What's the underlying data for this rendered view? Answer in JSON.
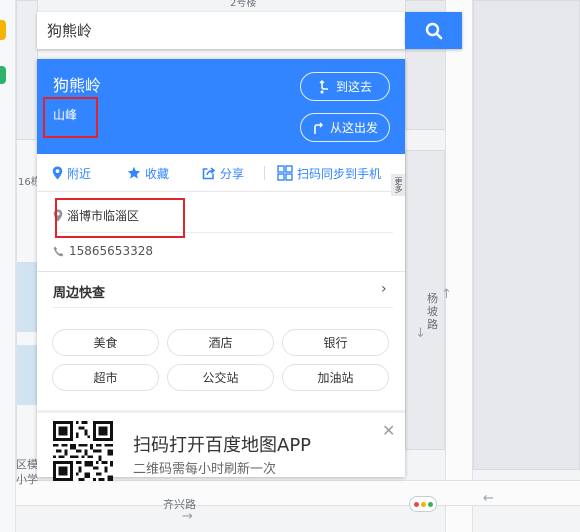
{
  "search": {
    "value": "狗熊岭",
    "clear_icon": "close-icon",
    "search_icon": "search-icon",
    "accent_color": "#3385ff"
  },
  "place": {
    "name": "狗熊岭",
    "category": "山峰",
    "go_here_label": "到这去",
    "depart_from_label": "从这出发",
    "header_color": "#3385ff"
  },
  "actions": [
    {
      "label": "附近",
      "icon": "location-pin-icon"
    },
    {
      "label": "收藏",
      "icon": "star-icon"
    },
    {
      "label": "分享",
      "icon": "share-icon"
    },
    {
      "label": "扫码同步到手机",
      "icon": "qr-scan-icon"
    }
  ],
  "more_tag": "更多",
  "info": {
    "address": "淄博市临淄区",
    "phone": "15865653328"
  },
  "nearby": {
    "title": "周边快查",
    "items": [
      "美食",
      "酒店",
      "银行",
      "超市",
      "公交站",
      "加油站"
    ]
  },
  "promo": {
    "title": "扫码打开百度地图APP",
    "subtitle": "二维码需每小时刷新一次",
    "close_icon": "close-icon"
  },
  "map_labels": {
    "road_top": "2号楼",
    "side_label": "16栋",
    "road_yangpo": "杨坡路",
    "road_qixing": "齐兴路",
    "bottom_left_1": "区模",
    "bottom_left_2": "小学"
  },
  "annotation_color": "#e0242a"
}
